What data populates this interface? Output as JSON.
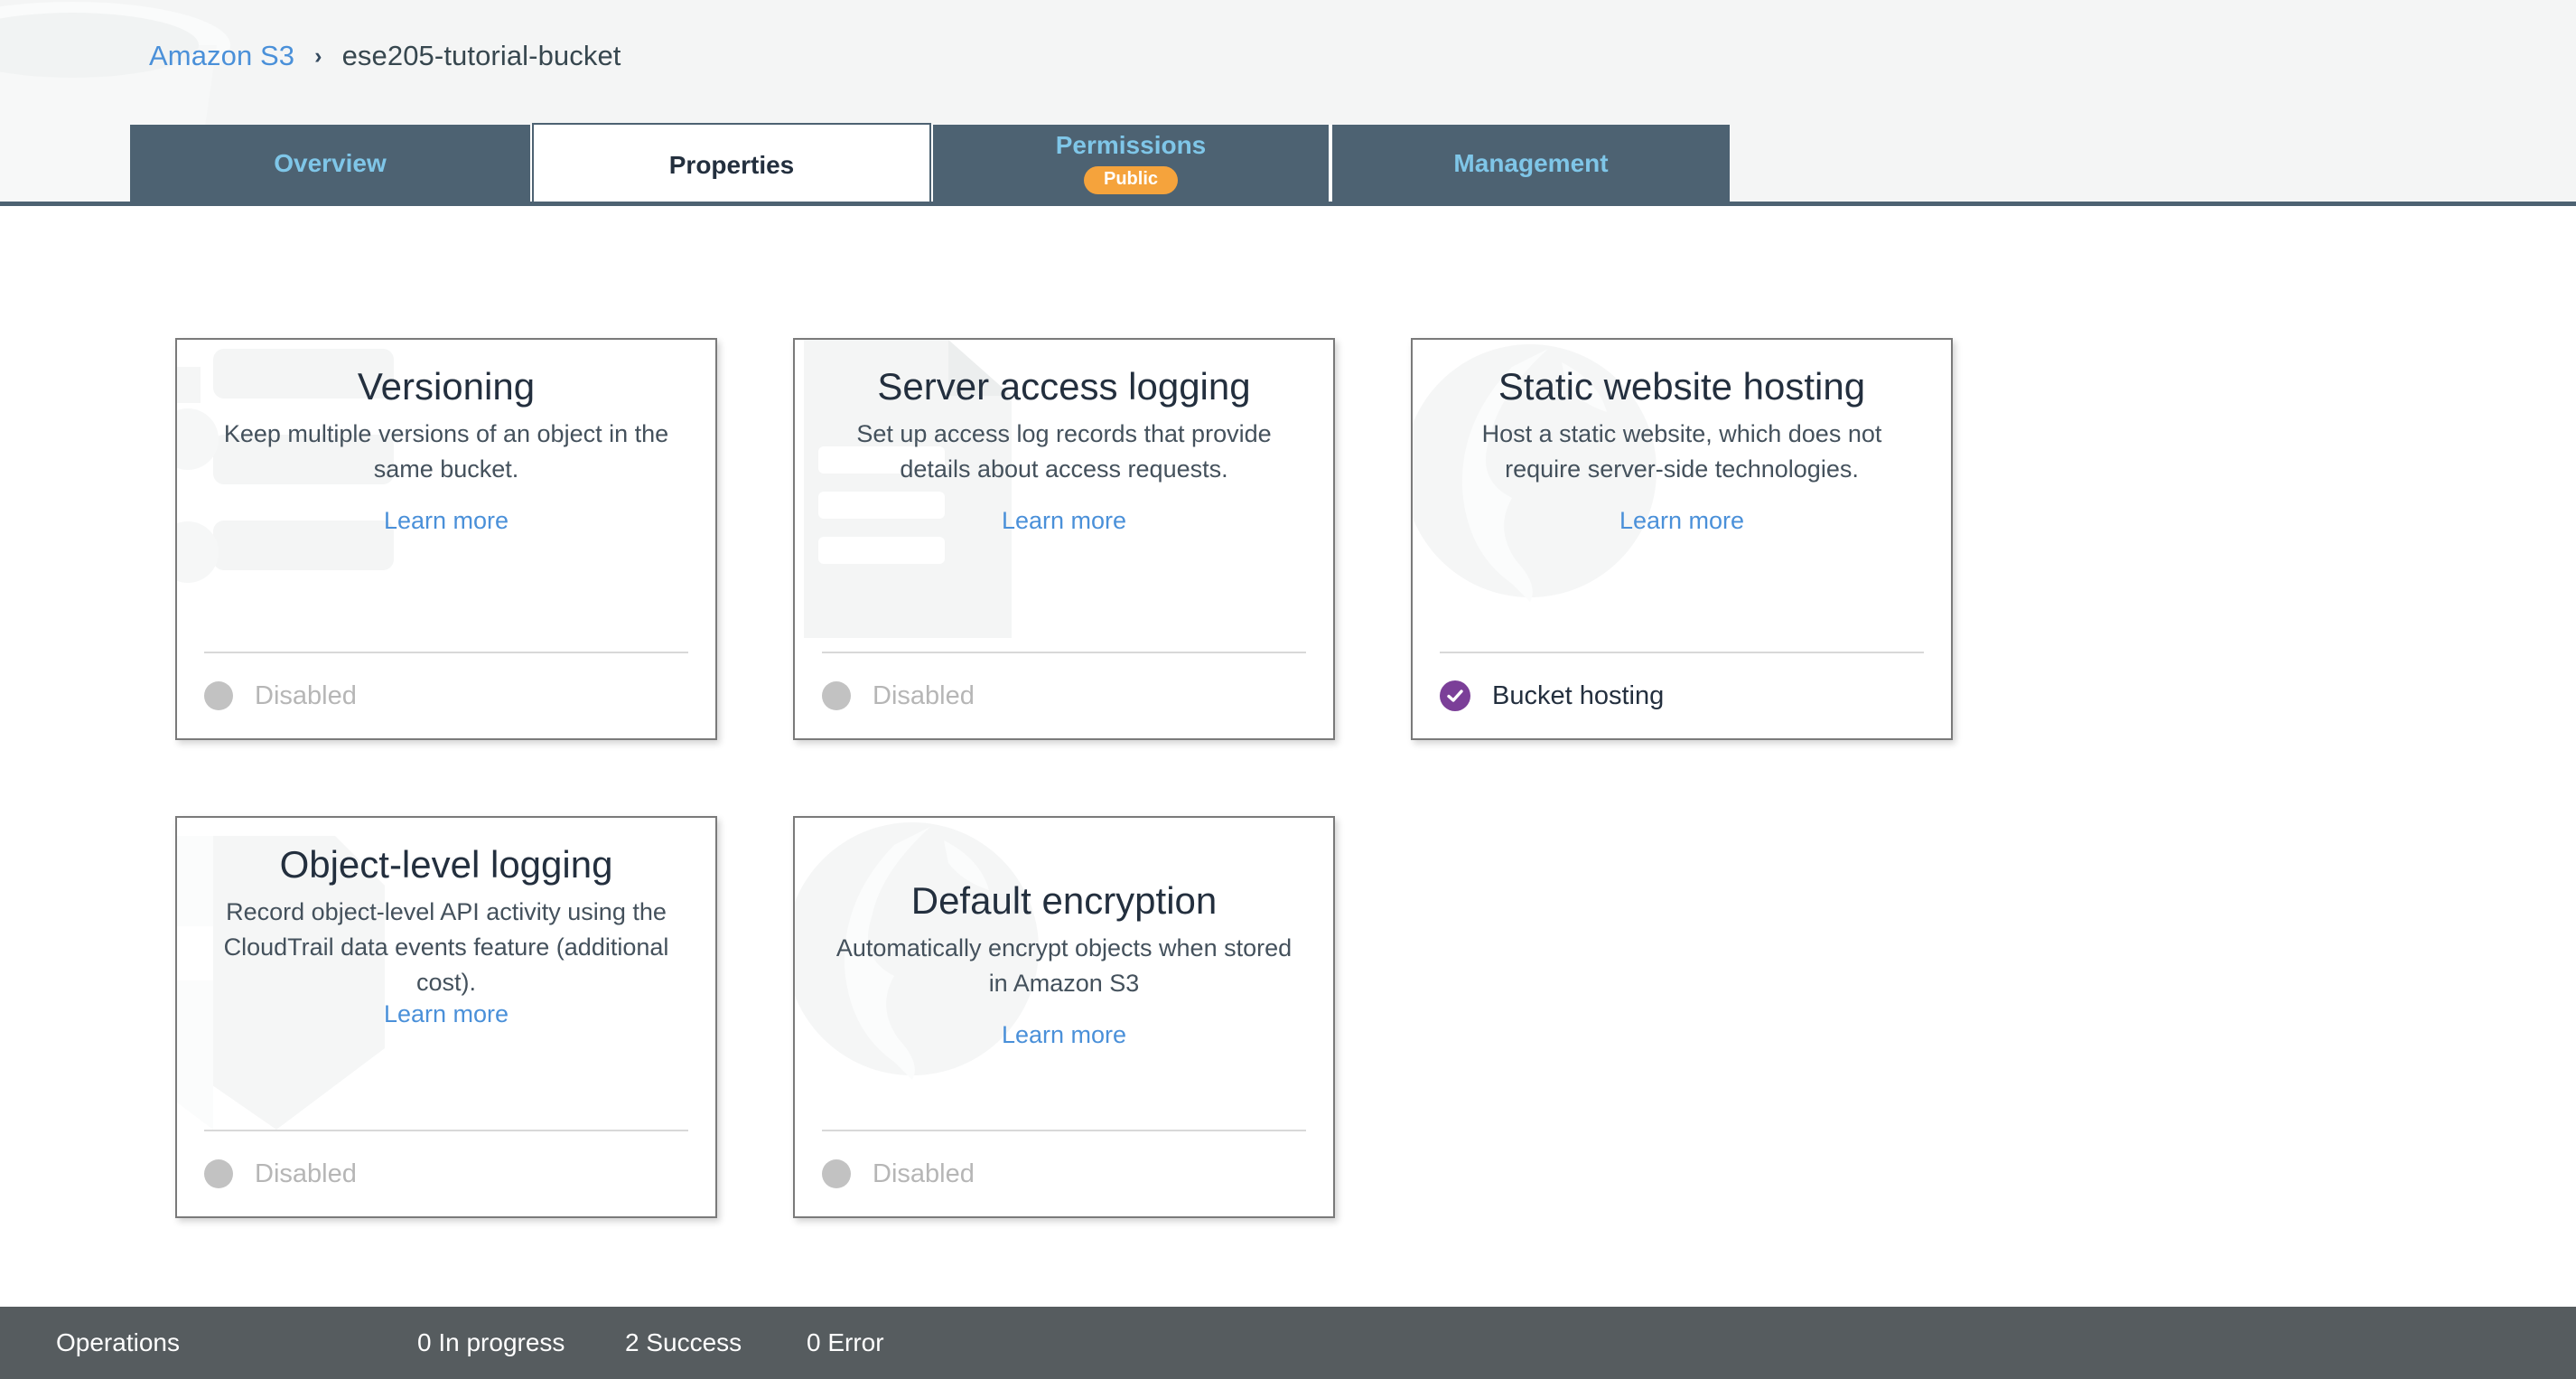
{
  "breadcrumb": {
    "root_label": "Amazon S3",
    "separator": "›",
    "current_label": "ese205-tutorial-bucket"
  },
  "tabs": [
    {
      "label": "Overview",
      "active": false,
      "badge": null
    },
    {
      "label": "Properties",
      "active": true,
      "badge": null
    },
    {
      "label": "Permissions",
      "active": false,
      "badge": "Public"
    },
    {
      "label": "Management",
      "active": false,
      "badge": null
    }
  ],
  "cards": [
    {
      "title": "Versioning",
      "description": "Keep multiple versions of an object in the same bucket.",
      "link_label": "Learn more",
      "status_label": "Disabled",
      "status_state": "disabled",
      "watermark": "bucket-icon"
    },
    {
      "title": "Server access logging",
      "description": "Set up access log records that provide details about access requests.",
      "link_label": "Learn more",
      "status_label": "Disabled",
      "status_state": "disabled",
      "watermark": "document-icon"
    },
    {
      "title": "Static website hosting",
      "description": "Host a static website, which does not require server-side technologies.",
      "link_label": "Learn more",
      "status_label": "Bucket hosting",
      "status_state": "enabled",
      "watermark": "globe-icon"
    },
    {
      "title": "Object-level logging",
      "description": "Record object-level API activity using the CloudTrail data events feature (additional cost).",
      "link_label": "Learn more",
      "status_label": "Disabled",
      "status_state": "disabled",
      "watermark": "shield-icon"
    },
    {
      "title": "Default encryption",
      "description": "Automatically encrypt objects when stored in Amazon S3",
      "link_label": "Learn more",
      "status_label": "Disabled",
      "status_state": "disabled",
      "watermark": "globe-icon"
    }
  ],
  "statusbar": {
    "operations_label": "Operations",
    "in_progress": "0 In progress",
    "success": "2 Success",
    "error": "0 Error"
  },
  "colors": {
    "tab_bg": "#4d6272",
    "tab_text": "#7fc6e8",
    "link": "#4a90d9",
    "badge_public": "#f5a33c",
    "status_enabled": "#7b3f98",
    "status_disabled": "#c2c2c2",
    "statusbar_bg": "#565c5f",
    "header_bg": "#f4f5f5"
  }
}
